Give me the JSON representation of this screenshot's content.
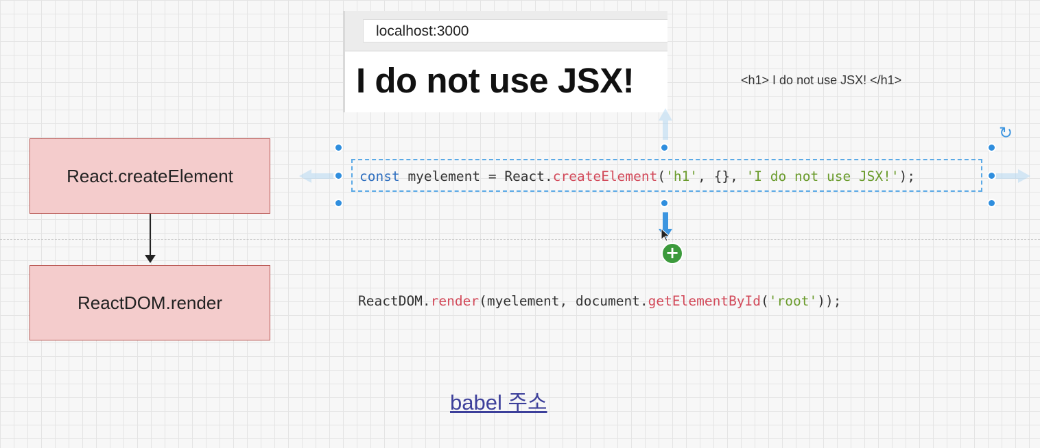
{
  "browser": {
    "url": "localhost:3000",
    "heading": "I do not use JSX!"
  },
  "note": "<h1> I do not use JSX! </h1>",
  "flow": {
    "box1": "React.createElement",
    "box2": "ReactDOM.render"
  },
  "code1": {
    "kw": "const",
    "before_fn": " myelement = React.",
    "fn": "createElement",
    "args_open": "(",
    "str1": "'h1'",
    "mid": ", {}, ",
    "str2": "'I do not use JSX!'",
    "end": ");"
  },
  "code2": {
    "start": "ReactDOM.",
    "fn1": "render",
    "mid": "(myelement, document.",
    "fn2": "getElementById",
    "open": "(",
    "str": "'root'",
    "end": "));"
  },
  "link": "babel 주소",
  "icons": {
    "rotate": "rotate-icon",
    "add": "plus-circle-icon"
  }
}
